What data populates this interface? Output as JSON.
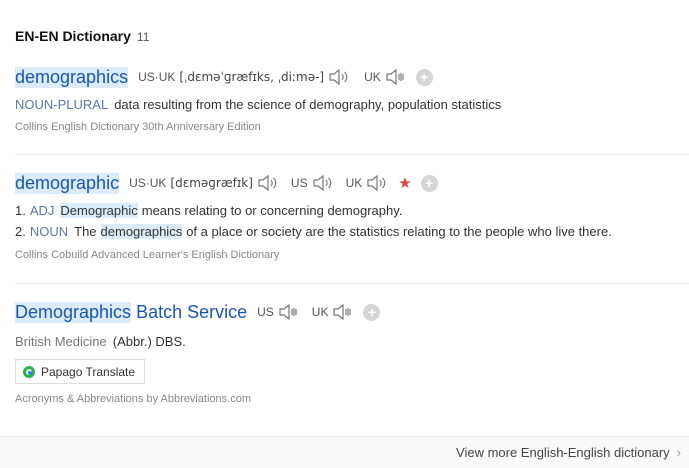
{
  "header": {
    "title": "EN-EN Dictionary",
    "count": "11"
  },
  "entries": [
    {
      "headword": "demographics",
      "pron_prefix": "US·UK",
      "ipa": "[ˌdɛməˈɡræfɪks, ˌdiːmə-]",
      "uk_label": "UK",
      "pos": "NOUN-PLURAL",
      "definition": "data resulting from the science of demography, population statistics",
      "source": "Collins English Dictionary 30th Anniversary Edition"
    },
    {
      "headword": "demographic",
      "pron_prefix": "US·UK",
      "ipa": "[dɛməɡræfɪk]",
      "us_label": "US",
      "uk_label": "UK",
      "senses": [
        {
          "num": "1.",
          "pos": "ADJ",
          "term": "Demographic",
          "text": "means relating to or concerning demography."
        },
        {
          "num": "2.",
          "pos": "NOUN",
          "pre": "The",
          "term": "demographics",
          "text": "of a place or society are the statistics relating to the people who live there."
        }
      ],
      "source": "Collins Cobuild Advanced Learner's English Dictionary"
    },
    {
      "headword_hl": "Demographics",
      "headword_rest": "Batch Service",
      "us_label": "US",
      "uk_label": "UK",
      "category": "British Medicine",
      "definition": "(Abbr.) DBS.",
      "translate_label": "Papago Translate",
      "source": "Acronyms & Abbreviations by Abbreviations.com"
    }
  ],
  "footer": {
    "more_label": "View more English-English dictionary"
  },
  "colors": {
    "headword": "#1a56b0",
    "highlight": "#dcebf8",
    "pos": "#5a78a3",
    "star": "#e0453a"
  }
}
